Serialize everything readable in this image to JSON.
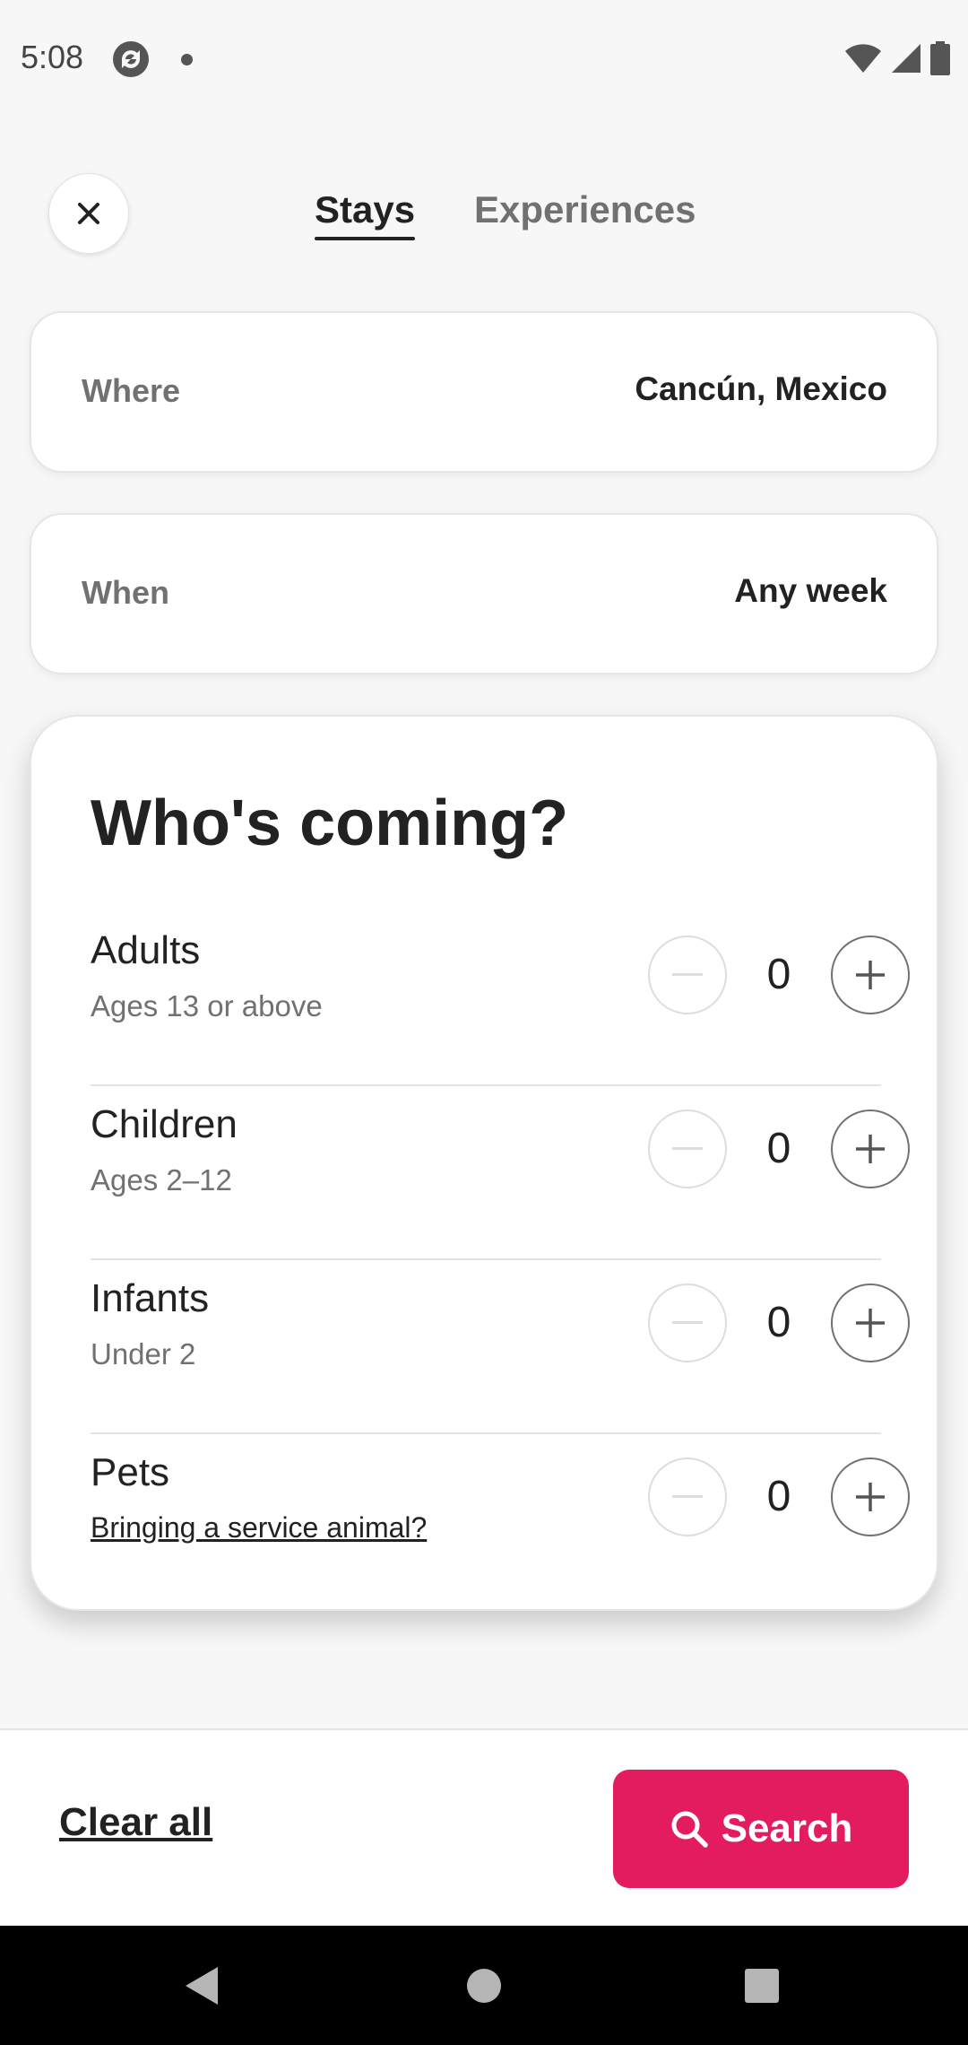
{
  "status_bar": {
    "time": "5:08"
  },
  "header": {
    "tabs": [
      {
        "label": "Stays",
        "active": true
      },
      {
        "label": "Experiences",
        "active": false
      }
    ]
  },
  "where": {
    "label": "Where",
    "value": "Cancún, Mexico"
  },
  "when": {
    "label": "When",
    "value": "Any week"
  },
  "guests": {
    "title": "Who's coming?",
    "rows": [
      {
        "name": "Adults",
        "sub": "Ages 13 or above",
        "count": "0"
      },
      {
        "name": "Children",
        "sub": "Ages 2–12",
        "count": "0"
      },
      {
        "name": "Infants",
        "sub": "Under 2",
        "count": "0"
      },
      {
        "name": "Pets",
        "sub": "Bringing a service animal?",
        "count": "0"
      }
    ]
  },
  "footer": {
    "clear_label": "Clear all",
    "search_label": "Search"
  },
  "colors": {
    "accent": "#e31c5f",
    "text_primary": "#222222",
    "text_secondary": "#717171"
  },
  "icons": {
    "close": "close-icon",
    "minus": "minus-icon",
    "plus": "plus-icon",
    "search": "search-icon"
  }
}
